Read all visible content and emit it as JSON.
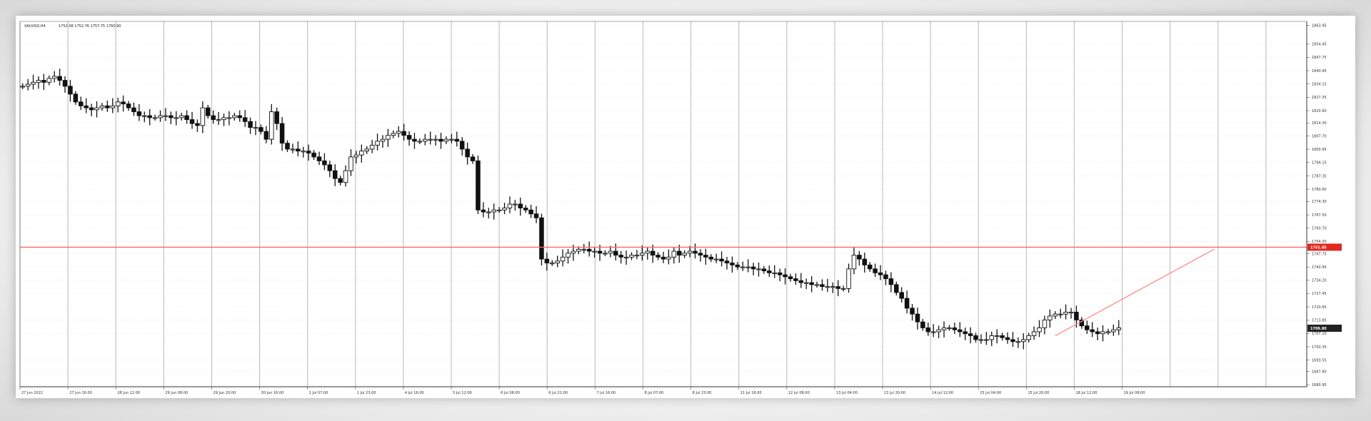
{
  "window": {
    "symbol_header": "XAUUSD,H4",
    "ohlc": "1752.08 1752.76 1757.75 1760.90"
  },
  "colors": {
    "candle": "#111111",
    "grid": "#bfbfbf",
    "price_line": "#ff6666",
    "price_label_bg": "#e0291f",
    "current_label_bg": "#222222",
    "trend_line": "#ff8a8a"
  },
  "chart_data": {
    "type": "candlestick",
    "title": "",
    "xlabel": "",
    "ylabel": "",
    "ylim": [
      1680,
      1866
    ],
    "grid": true,
    "x_ticks": [
      "27 Jun 2022",
      "27 Jun 16:00",
      "28 Jun 12:00",
      "29 Jun 08:00",
      "29 Jun 20:00",
      "30 Jun 16:00",
      "1 Jul 07:00",
      "1 Jul 23:00",
      "4 Jul 16:00",
      "5 Jul 12:00",
      "6 Jul 08:00",
      "6 Jul 21:00",
      "7 Jul 16:00",
      "8 Jul 07:00",
      "8 Jul 23:00",
      "11 Jul 16:00",
      "12 Jul 08:00",
      "13 Jul 04:00",
      "13 Jul 20:00",
      "14 Jul 12:00",
      "15 Jul 04:00",
      "15 Jul 20:00",
      "18 Jul 12:00",
      "19 Jul 08:00"
    ],
    "y_ticks": [
      "1863.95",
      "1854.45",
      "1847.75",
      "1840.95",
      "1834.15",
      "1827.35",
      "1820.60",
      "1814.30",
      "1807.70",
      "1800.95",
      "1794.15",
      "1787.35",
      "1780.60",
      "1774.30",
      "1767.50",
      "1760.70",
      "1754.00",
      "1747.75",
      "1740.95",
      "1734.20",
      "1727.45",
      "1720.65",
      "1713.85",
      "1707.10",
      "1700.35",
      "1693.55",
      "1687.80",
      "1680.95"
    ],
    "horizontal_line": {
      "price": 1751.05,
      "label": "1751.05"
    },
    "current_price": {
      "price": 1709.8,
      "label": "1709.80"
    },
    "trend_line": {
      "from": {
        "index": 195,
        "price": 1706
      },
      "to": {
        "index": 225,
        "price": 1750
      }
    },
    "projection_slots": 35,
    "close": [
      1833,
      1834,
      1835,
      1836,
      1835,
      1837,
      1838,
      1836,
      1833,
      1829,
      1825,
      1823,
      1822,
      1821,
      1822,
      1823,
      1822,
      1823,
      1825,
      1824,
      1822,
      1820,
      1818,
      1818,
      1817,
      1817,
      1818,
      1818,
      1817,
      1817,
      1818,
      1816,
      1814,
      1813,
      1822,
      1818,
      1816,
      1816,
      1817,
      1817,
      1818,
      1817,
      1815,
      1812,
      1812,
      1810,
      1806,
      1820,
      1814,
      1804,
      1801,
      1801,
      1800,
      1800,
      1799,
      1797,
      1795,
      1793,
      1790,
      1786,
      1784,
      1790,
      1797,
      1798,
      1800,
      1801,
      1803,
      1805,
      1806,
      1808,
      1809,
      1810,
      1808,
      1806,
      1805,
      1805,
      1806,
      1806,
      1806,
      1805,
      1806,
      1806,
      1805,
      1801,
      1797,
      1795,
      1770,
      1769,
      1769,
      1770,
      1770,
      1771,
      1773,
      1773,
      1771,
      1770,
      1768,
      1766,
      1745,
      1743,
      1743,
      1744,
      1746,
      1748,
      1749,
      1750,
      1750,
      1749,
      1749,
      1748,
      1748,
      1749,
      1747,
      1746,
      1746,
      1747,
      1747,
      1748,
      1749,
      1747,
      1746,
      1745,
      1746,
      1749,
      1747,
      1748,
      1749,
      1748,
      1747,
      1746,
      1745,
      1745,
      1744,
      1743,
      1742,
      1741,
      1741,
      1741,
      1740,
      1740,
      1739,
      1738,
      1738,
      1737,
      1736,
      1735,
      1734,
      1733,
      1733,
      1732,
      1732,
      1731,
      1731,
      1731,
      1730,
      1730,
      1740,
      1747,
      1745,
      1742,
      1740,
      1738,
      1737,
      1735,
      1732,
      1728,
      1725,
      1720,
      1717,
      1713,
      1710,
      1708,
      1708,
      1709,
      1710,
      1710,
      1709,
      1708,
      1707,
      1706,
      1704,
      1704,
      1704,
      1706,
      1706,
      1705,
      1704,
      1703,
      1703,
      1704,
      1706,
      1708,
      1710,
      1714,
      1716,
      1717,
      1717,
      1718,
      1718,
      1714,
      1711,
      1709,
      1708,
      1707,
      1708,
      1708,
      1709,
      1710
    ]
  }
}
